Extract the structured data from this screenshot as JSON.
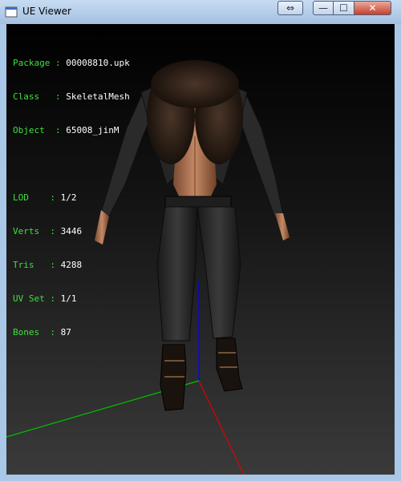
{
  "window": {
    "title": "UE Viewer"
  },
  "titlebar_buttons": {
    "swap": "⇔",
    "minimize": "—",
    "maximize": "☐",
    "close": "✕"
  },
  "info": {
    "package": {
      "label": "Package",
      "value": "00008810.upk"
    },
    "class": {
      "label": "Class  ",
      "value": "SkeletalMesh"
    },
    "object": {
      "label": "Object ",
      "value": "65008_jinM"
    },
    "lod": {
      "label": "LOD   ",
      "value": "1/2"
    },
    "verts": {
      "label": "Verts ",
      "value": "3446"
    },
    "tris": {
      "label": "Tris  ",
      "value": "4288"
    },
    "uvset": {
      "label": "UV Set",
      "value": "1/1"
    },
    "bones": {
      "label": "Bones ",
      "value": "87"
    }
  },
  "colors": {
    "label": "#3ee03e",
    "axis_x": "#e00000",
    "axis_y": "#00c000",
    "axis_z": "#0000ff"
  }
}
